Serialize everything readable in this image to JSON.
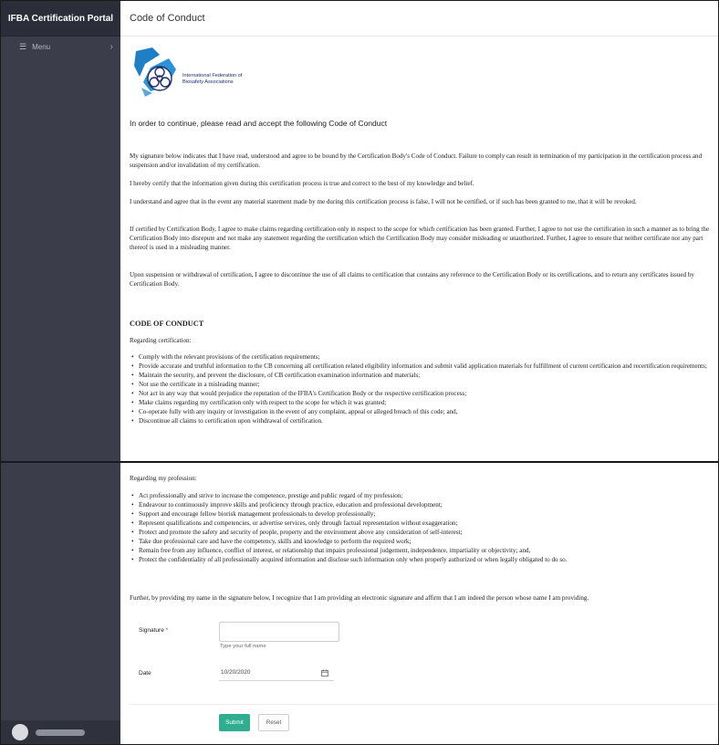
{
  "sidebar": {
    "brand": "IFBA Certification Portal",
    "menu_label": "Menu"
  },
  "header": {
    "title": "Code of Conduct"
  },
  "logo": {
    "org_name": "International Federation of Biosafety Associations"
  },
  "intro": "In order to continue, please read and accept the following Code of Conduct",
  "paragraphs": [
    "My signature below indicates that I have read, understood and agree to be bound by the Certification Body's Code of Conduct. Failure to comply can result in termination of my participation in the certification process and suspension and/or invalidation of my certification.",
    "I hereby certify that the information given during this certification process is true and correct to the best of my knowledge and belief.",
    "I understand and agree that in the event any material statement made by me during this certification process is false, I will not be certified, or if such has been granted to me, that it will be revoked.",
    "If certified by Certification Body, I agree to make claims regarding certification only in respect to the scope for which certification has been granted. Further, I agree to not use the certification in such a manner as to bring the Certification Body into disrepute and not make any statement regarding the certification which the Certification Body may consider misleading or unauthorized. Further, I agree to ensure that neither certificate nor any part thereof is used in a misleading manner.",
    "Upon suspension or withdrawal of certification, I agree to discontinue the use of all claims to certification that contains any reference to the Certification Body or its certifications, and to return any certificates issued by Certification Body."
  ],
  "coc_heading": "CODE OF CONDUCT",
  "certification": {
    "heading": "Regarding certification:",
    "items": [
      "Comply with the relevant provisions of the certification requirements;",
      "Provide accurate and truthful information to the CB concerning all certification related eligibility information and submit valid application materials for fulfillment of current certification and recertification requirements;",
      "Maintain the security, and prevent the disclosure, of CB certification examination information and materials;",
      "Not use the certificate in a misleading manner;",
      "Not act in any way that would prejudice the reputation of the IFBA's Certification Body or the respective certification process;",
      "Make claims regarding my certification only with respect to the scope for which it was granted;",
      "Co-operate fully with any inquiry or investigation in the event of any complaint, appeal or alleged breach of this code; and,",
      "Discontinue all claims to certification upon withdrawal of certification."
    ]
  },
  "profession": {
    "heading": "Regarding my profession:",
    "items": [
      "Act professionally and strive to increase the competence, prestige and public regard of my profession;",
      "Endeavour to continuously improve skills and proficiency through practice, education and professional development;",
      "Support and encourage fellow biorisk management professionals to develop professionally;",
      "Represent qualifications and competencies, or advertise services, only through factual representation without exaggeration;",
      "Protect and promote the safety and security of people, property and the environment above any consideration of self-interest;",
      "Take due professional care and have the competency, skills and knowledge to perform the required work;",
      "Remain free from any influence, conflict of interest, or relationship that impairs professional judgement, independence, impartiality or objectivity;  and,",
      "Protect the confidentiality of all professionally acquired information and disclose such information only when properly authorized or when legally obligated to do so."
    ]
  },
  "closing": "Further, by providing my name in the signature below, I recognize that I am providing an electronic signature and affirm that I am indeed the person whose name I am providing.",
  "form": {
    "signature_label": "Signature",
    "required_mark": "*",
    "signature_value": "",
    "signature_hint": "Type your full name",
    "date_label": "Date",
    "date_value": "10/20/2020",
    "submit_label": "Submit",
    "reset_label": "Reset"
  },
  "colors": {
    "sidebar_bg": "#3b3d4a",
    "sidebar_header_bg": "#2b2d38",
    "submit_bg": "#2fae8f",
    "logo_blue": "#1f2f6e"
  }
}
